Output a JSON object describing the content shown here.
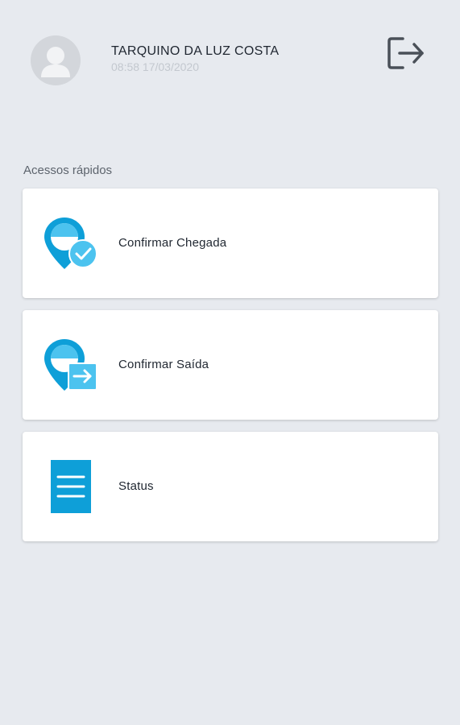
{
  "header": {
    "user_name": "TARQUINO DA LUZ COSTA",
    "datetime": "08:58 17/03/2020",
    "avatar_icon": "user-avatar-icon",
    "logout_icon": "logout-icon"
  },
  "quick_access": {
    "title": "Acessos rápidos",
    "items": [
      {
        "label": "Confirmar Chegada",
        "icon": "location-check-icon"
      },
      {
        "label": "Confirmar Saída",
        "icon": "location-exit-icon"
      },
      {
        "label": "Status",
        "icon": "document-icon"
      }
    ]
  },
  "colors": {
    "background": "#e7eaef",
    "card": "#ffffff",
    "accent": "#0e9fd8",
    "accent_light": "#4cc3ef",
    "text_primary": "#1f2630",
    "text_muted": "#c3c8cf"
  }
}
